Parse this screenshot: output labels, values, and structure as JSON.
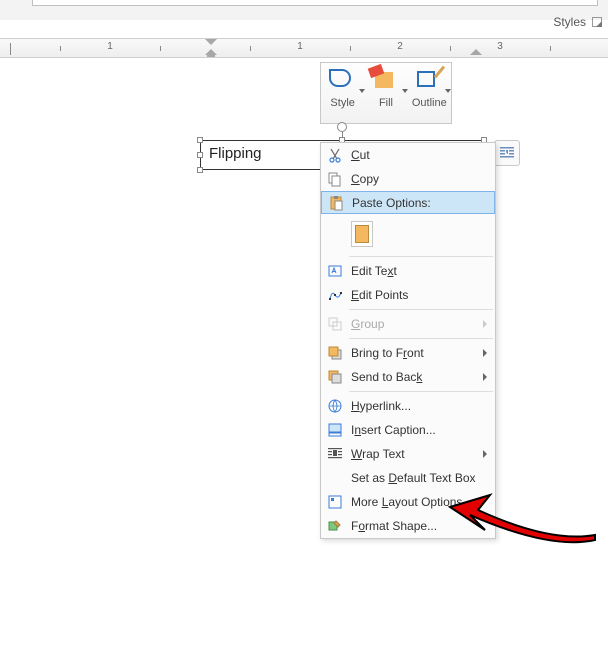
{
  "ribbon": {
    "group_label": "Styles"
  },
  "ruler": {
    "numbers": [
      1,
      1,
      2,
      3
    ]
  },
  "mini_toolbar": {
    "style": "Style",
    "fill": "Fill",
    "outline": "Outline"
  },
  "text_box": {
    "content": "Flipping"
  },
  "context_menu": {
    "cut": "Cut",
    "copy": "Copy",
    "paste_options": "Paste Options:",
    "edit_text": "Edit Text",
    "edit_points": "Edit Points",
    "group": "Group",
    "bring_front": "Bring to Front",
    "send_back": "Send to Back",
    "hyperlink": "Hyperlink...",
    "insert_caption": "Insert Caption...",
    "wrap_text": "Wrap Text",
    "set_default": "Set as Default Text Box",
    "more_layout": "More Layout Options...",
    "format_shape": "Format Shape..."
  }
}
